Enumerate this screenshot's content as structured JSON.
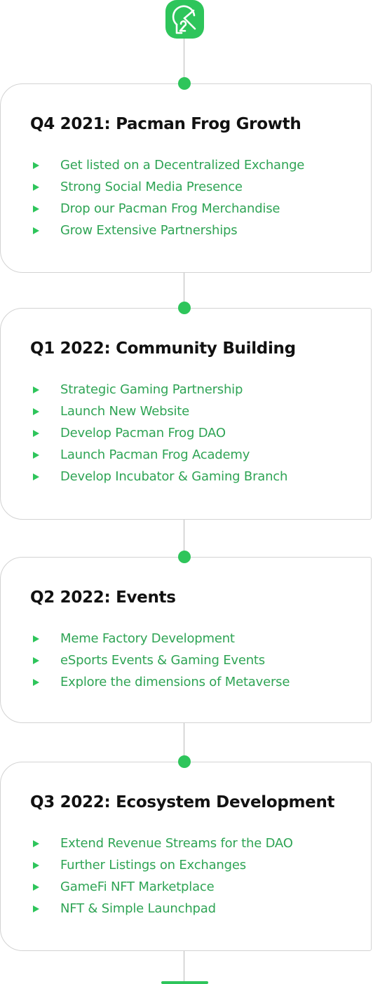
{
  "colors": {
    "accent": "#2ec55b",
    "item_text": "#2fa455",
    "title_text": "#111111",
    "border": "#d3d3d3"
  },
  "logo": {
    "icon": "pacman-frog-logo-icon"
  },
  "roadmap": [
    {
      "title": "Q4 2021: Pacman Frog Growth",
      "items": [
        "Get listed on a Decentralized Exchange",
        "Strong Social Media Presence",
        "Drop our Pacman Frog Merchandise",
        "Grow Extensive Partnerships"
      ]
    },
    {
      "title": "Q1 2022: Community Building",
      "items": [
        "Strategic Gaming Partnership",
        "Launch New Website",
        "Develop Pacman Frog DAO",
        "Launch Pacman Frog Academy",
        "Develop Incubator & Gaming Branch"
      ]
    },
    {
      "title": "Q2 2022: Events",
      "items": [
        "Meme Factory Development",
        "eSports Events & Gaming Events",
        "Explore the dimensions of Metaverse"
      ]
    },
    {
      "title": "Q3 2022: Ecosystem Development",
      "items": [
        "Extend Revenue Streams for the DAO",
        "Further Listings on Exchanges",
        "GameFi NFT Marketplace",
        "NFT & Simple Launchpad"
      ]
    }
  ]
}
